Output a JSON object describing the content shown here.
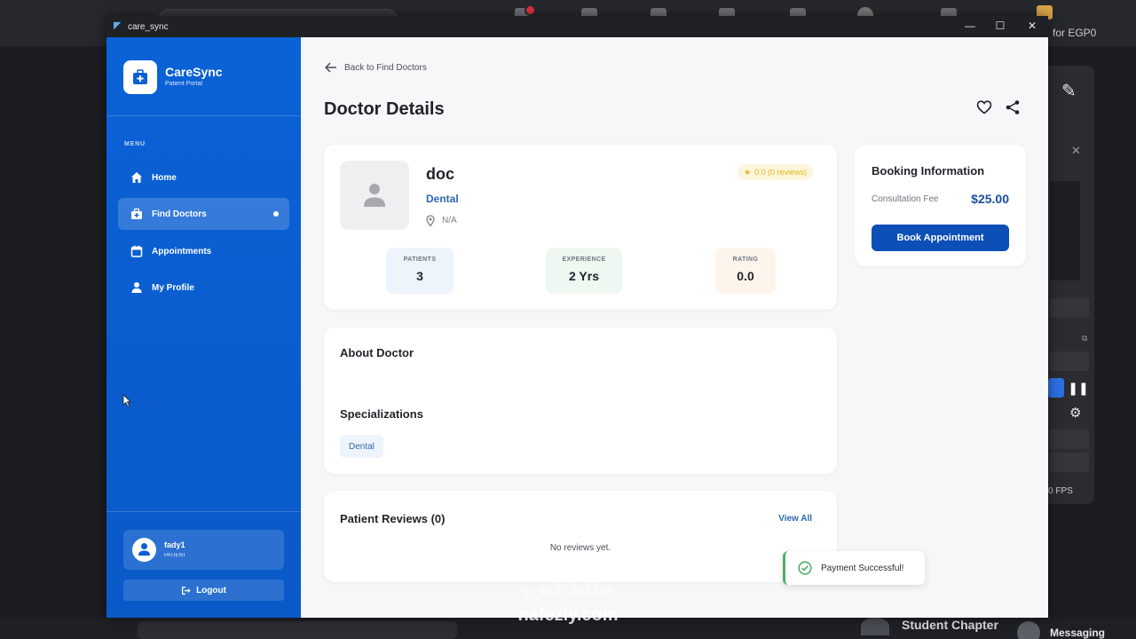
{
  "window": {
    "title": "care_sync"
  },
  "background": {
    "taskbar_fragment": "for EGP0",
    "student_chapter": "Student Chapter",
    "messaging": "Messaging",
    "fps": "0 FPS"
  },
  "sidebar": {
    "brand_name": "CareSync",
    "brand_sub": "Patient Portal",
    "menu_label": "MENU",
    "items": [
      {
        "label": "Home",
        "icon": "home-icon"
      },
      {
        "label": "Find Doctors",
        "icon": "medical-bag-icon",
        "active": true
      },
      {
        "label": "Appointments",
        "icon": "calendar-icon"
      },
      {
        "label": "My Profile",
        "icon": "person-icon"
      }
    ],
    "user": {
      "name": "fady1",
      "role": "PATIENT"
    },
    "logout_label": "Logout"
  },
  "main": {
    "back_label": "Back to Find Doctors",
    "page_title": "Doctor Details",
    "doctor": {
      "name": "doc",
      "specialty": "Dental",
      "location": "N/A",
      "rating_badge": "0.0 (0 reviews)",
      "stats": [
        {
          "label": "PATIENTS",
          "value": "3"
        },
        {
          "label": "EXPERIENCE",
          "value": "2 Yrs"
        },
        {
          "label": "RATING",
          "value": "0.0"
        }
      ]
    },
    "booking": {
      "title": "Booking Information",
      "fee_label": "Consultation Fee",
      "fee_value": "$25.00",
      "button_label": "Book Appointment"
    },
    "about": {
      "title": "About Doctor",
      "specializations_title": "Specializations",
      "specializations": [
        "Dental"
      ]
    },
    "reviews": {
      "title": "Patient Reviews (0)",
      "view_all": "View All",
      "empty": "No reviews yet."
    }
  },
  "toast": {
    "message": "Payment Successful!"
  },
  "watermark": {
    "arabic": "نفذلي",
    "latin": "nafezly.com"
  },
  "colors": {
    "sidebar": "#0a5fd3",
    "primary_button": "#0b4fb7",
    "link": "#2c68b4",
    "rating_star": "#e3b419",
    "toast_accent": "#4caf6a"
  }
}
